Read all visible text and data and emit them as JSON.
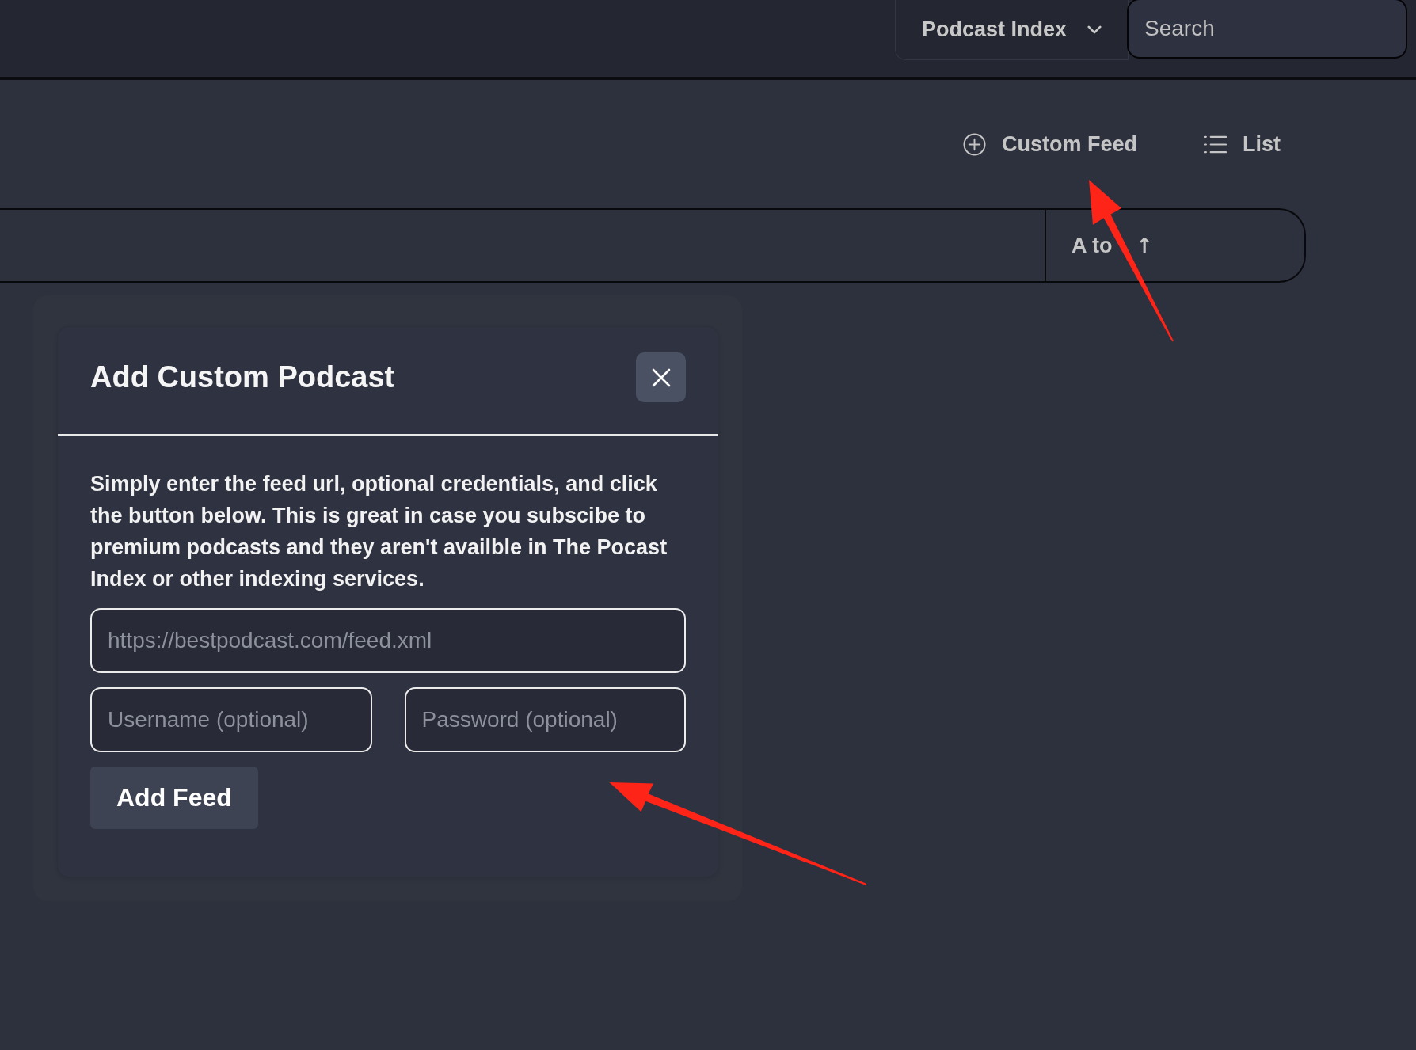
{
  "top_bar": {
    "source_dropdown": {
      "label": "Podcast Index"
    },
    "search": {
      "placeholder": "Search"
    }
  },
  "toolbar": {
    "buttons": [
      {
        "label": "Custom Feed",
        "kind": "add"
      },
      {
        "label": "List",
        "kind": "list"
      }
    ]
  },
  "filter_bar": {
    "sort": {
      "label": "A to",
      "direction": "↑"
    }
  },
  "modal": {
    "title": "Add Custom Podcast",
    "description": "Simply enter the feed url, optional credentials, and click the button below. This is great in case you subscibe to premium podcasts and they aren't availble in The Pocast Index or other indexing services.",
    "fields": [
      {
        "kind": "url",
        "placeholder": "https://bestpodcast.com/feed.xml"
      },
      {
        "kind": "username",
        "placeholder": "Username (optional)"
      },
      {
        "kind": "password",
        "placeholder": "Password (optional)"
      }
    ],
    "submit_button": "Add Feed"
  }
}
